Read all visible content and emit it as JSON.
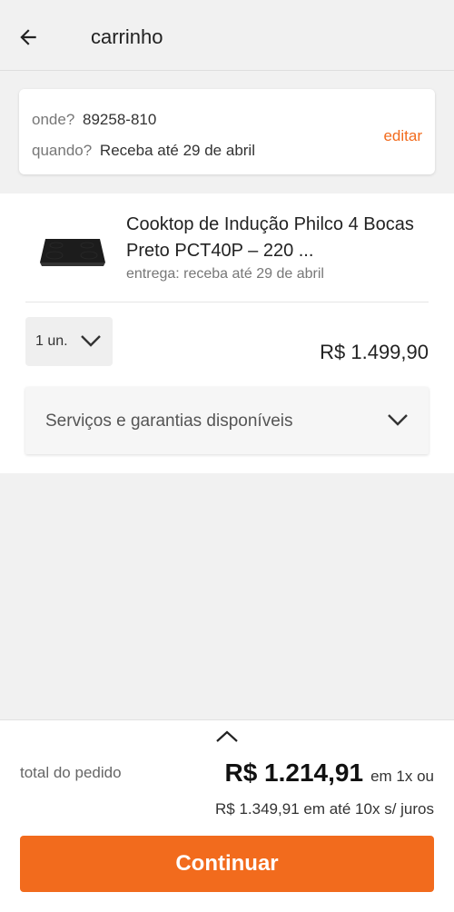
{
  "header": {
    "title": "carrinho",
    "back_icon": "arrow-left-icon"
  },
  "delivery": {
    "where_label": "onde?",
    "where_value": "89258-810",
    "when_label": "quando?",
    "when_value": "Receba até 29 de abril",
    "edit_label": "editar"
  },
  "product": {
    "name": "Cooktop de Indução Philco 4 Bocas Preto PCT40P – 220 ...",
    "delivery_text": "entrega: receba até 29 de abril",
    "quantity": "1 un.",
    "price": "R$ 1.499,90",
    "services_label": "Serviços e garantias disponíveis"
  },
  "footer": {
    "total_label": "total do pedido",
    "total_value": "R$ 1.214,91",
    "total_suffix": "em 1x ou",
    "installments": "R$ 1.349,91 em até 10x s/ juros",
    "continue_label": "Continuar"
  },
  "colors": {
    "accent": "#f26b1d",
    "background": "#f1f1f1"
  }
}
